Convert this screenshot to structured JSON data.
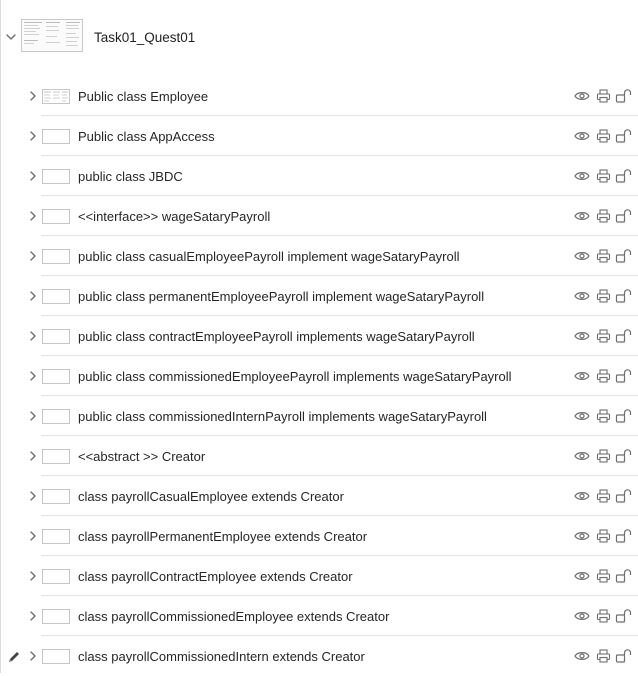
{
  "layer_panel": {
    "page": {
      "title": "Task01_Quest01",
      "expanded": true
    },
    "rows": [
      {
        "label": "Public class Employee",
        "thumb": "lined"
      },
      {
        "label": "Public class AppAccess"
      },
      {
        "label": "public class JBDC"
      },
      {
        "label": "<<interface>> wageSataryPayroll"
      },
      {
        "label": "public class casualEmployeePayroll implement wageSataryPayroll"
      },
      {
        "label": "public class permanentEmployeePayroll implement wageSataryPayroll"
      },
      {
        "label": "public class contractEmployeePayroll implements wageSataryPayroll"
      },
      {
        "label": "public class commissionedEmployeePayroll implements wageSataryPayroll"
      },
      {
        "label": "public class commissionedInternPayroll implements wageSataryPayroll"
      },
      {
        "label": "<<abstract >> Creator"
      },
      {
        "label": "class payrollCasualEmployee extends Creator"
      },
      {
        "label": "class payrollPermanentEmployee extends Creator"
      },
      {
        "label": "class payrollContractEmployee extends Creator"
      },
      {
        "label": "class payrollCommissionedEmployee extends Creator"
      },
      {
        "label": "class payrollCommissionedIntern extends Creator",
        "editing": true
      }
    ],
    "icons": {
      "row_actions": [
        "eye-icon",
        "printer-icon",
        "unlock-icon"
      ],
      "disclosure": "chevron-right-icon",
      "expanded": "chevron-down-icon",
      "edit_marker": "pencil-icon"
    },
    "colors": {
      "icon": "#6e6e6e",
      "separator": "#e2e2e2",
      "text": "#262626"
    }
  }
}
